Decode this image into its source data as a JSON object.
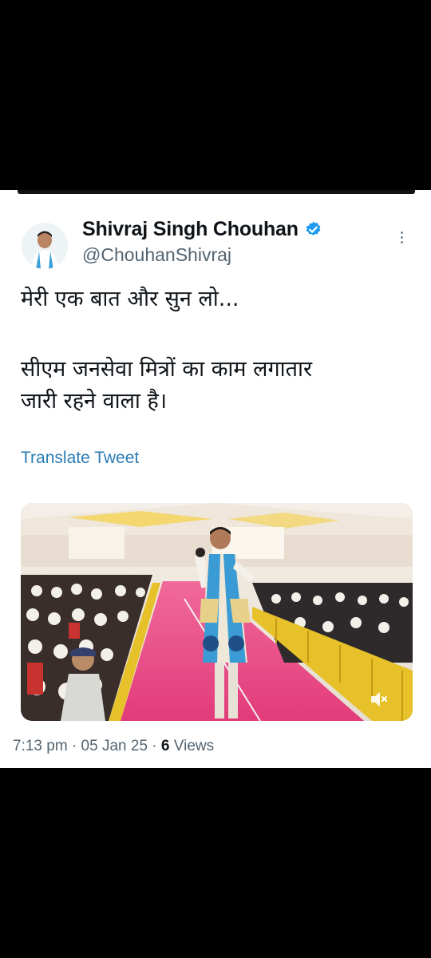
{
  "tweet": {
    "author_name": "Shivraj Singh Chouhan",
    "handle": "@ChouhanShivraj",
    "text_line1": "मेरी एक बात और सुन लो...",
    "text_line2": "सीएम जनसेवा मित्रों का काम लगातार",
    "text_line3": "जारी रहने वाला है।",
    "translate_label": "Translate Tweet",
    "time": "7:13 pm",
    "separator": " · ",
    "date": "05 Jan 25",
    "views_count": "6",
    "views_label": " Views"
  },
  "icons": {
    "verified": "verified-badge-icon",
    "more": "more-vertical-icon",
    "mute": "volume-muted-icon"
  },
  "colors": {
    "verified_blue": "#1d9bf0",
    "link_blue": "#2a7cb6",
    "muted_text": "#536471",
    "carpet_pink": "#e23b7a"
  }
}
